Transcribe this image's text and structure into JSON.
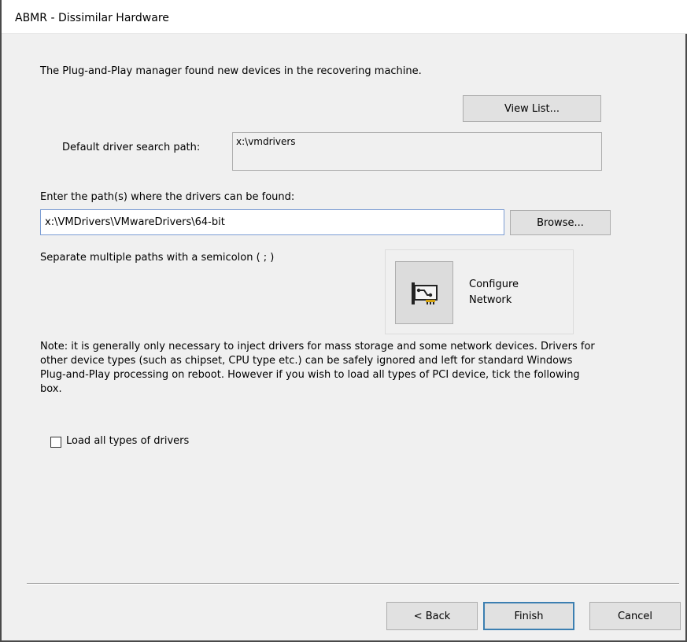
{
  "window": {
    "title": "ABMR - Dissimilar Hardware"
  },
  "intro": {
    "text": "The Plug-and-Play manager found new devices in the recovering machine."
  },
  "view_list_button": {
    "label": "View List..."
  },
  "default_driver_path": {
    "label": "Default driver search path:",
    "value": "x:\\vmdrivers"
  },
  "driver_paths": {
    "label": "Enter the path(s) where the drivers can be found:",
    "value": "x:\\VMDrivers\\VMwareDrivers\\64-bit"
  },
  "browse_button": {
    "label": "Browse..."
  },
  "separator_hint": {
    "text": "Separate multiple paths with a semicolon ( ; )"
  },
  "configure_network": {
    "label_line1": "Configure",
    "label_line2": "Network",
    "icon": "network-card-icon"
  },
  "note": {
    "text": "Note: it is generally only necessary to inject drivers for mass storage and some network devices. Drivers for other device types (such as chipset, CPU type etc.) can be safely ignored and left for standard Windows Plug-and-Play processing on reboot. However if you wish to load all types of PCI device, tick the following box."
  },
  "load_all_drivers": {
    "label": "Load all types of drivers",
    "checked": false
  },
  "footer": {
    "back_label": "< Back",
    "finish_label": "Finish",
    "cancel_label": "Cancel"
  }
}
